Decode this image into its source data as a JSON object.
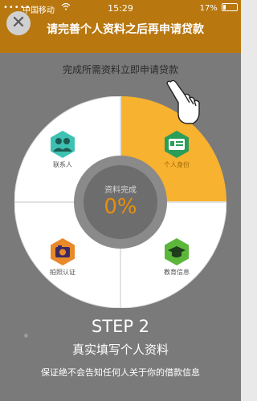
{
  "status_bar": {
    "carrier": "中国移动",
    "time": "15:29",
    "battery": "17%",
    "wifi_icon": "wifi-icon",
    "battery_icon": "battery-icon"
  },
  "header": {
    "title": "请完善个人资料之后再申请贷款",
    "close_icon": "close-icon"
  },
  "subtitle": "完成所需资料立即申请贷款",
  "wheel": {
    "segments": [
      {
        "label": "联系人",
        "icon": "contacts-icon",
        "color": "#3ec1b2"
      },
      {
        "label": "个人身份",
        "icon": "id-card-icon",
        "color": "#2a9d58",
        "active": true
      },
      {
        "label": "拍照认证",
        "icon": "camera-icon",
        "color": "#e8892a"
      },
      {
        "label": "教育信息",
        "icon": "graduation-cap-icon",
        "color": "#5bb63a"
      }
    ],
    "center_title": "资料完成",
    "progress": "0%",
    "accent_color": "#f7b22f"
  },
  "tutorial": {
    "step": "STEP 2",
    "description": "真实填写个人资料",
    "note": "保证绝不会告知任何人关于你的借款信息"
  }
}
